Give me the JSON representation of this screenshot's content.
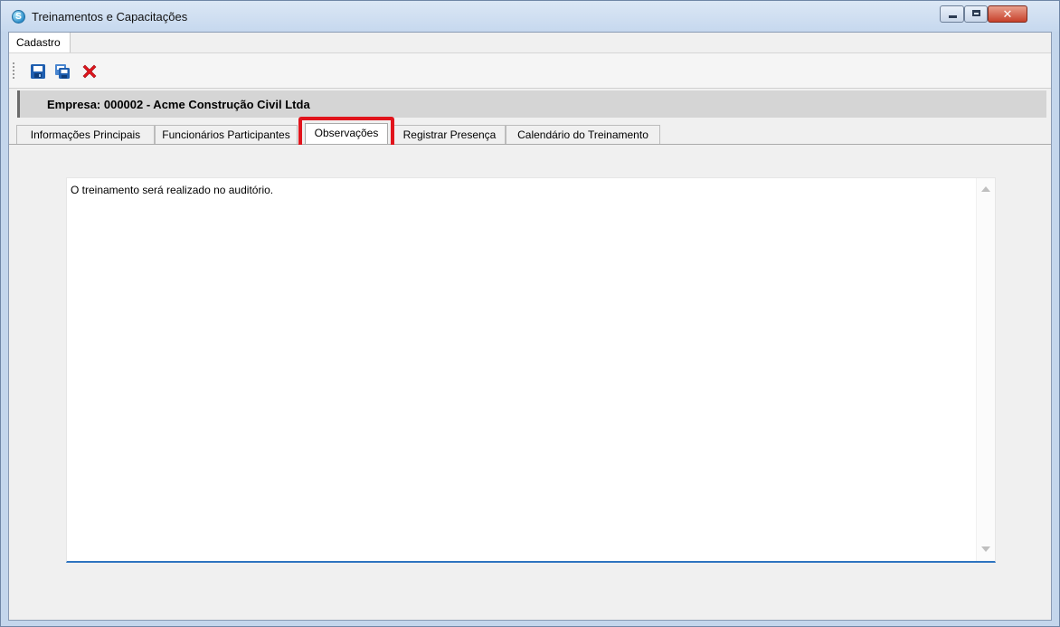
{
  "window": {
    "title": "Treinamentos e Capacitações",
    "minimize_glyph": "",
    "maximize_glyph": "",
    "close_glyph": "✕"
  },
  "menu": {
    "items": [
      "Cadastro"
    ]
  },
  "toolbar": {
    "buttons": [
      {
        "name": "save",
        "icon": "save-icon"
      },
      {
        "name": "save-copy",
        "icon": "save-copy-icon"
      },
      {
        "name": "delete",
        "icon": "delete-x-icon"
      }
    ]
  },
  "company": {
    "text": "Empresa:  000002 - Acme Construção Civil Ltda"
  },
  "tabs": [
    "Informações Principais",
    "Funcionários Participantes",
    "Observações",
    "Registrar Presença",
    "Calendário do Treinamento"
  ],
  "active_tab": "Observações",
  "notes": {
    "value": "O treinamento será realizado no auditório."
  },
  "colors": {
    "highlight": "#e1141c",
    "focus_underline": "#2e74c0",
    "delete_icon": "#e0141c",
    "save_icon": "#1f5fb0"
  }
}
